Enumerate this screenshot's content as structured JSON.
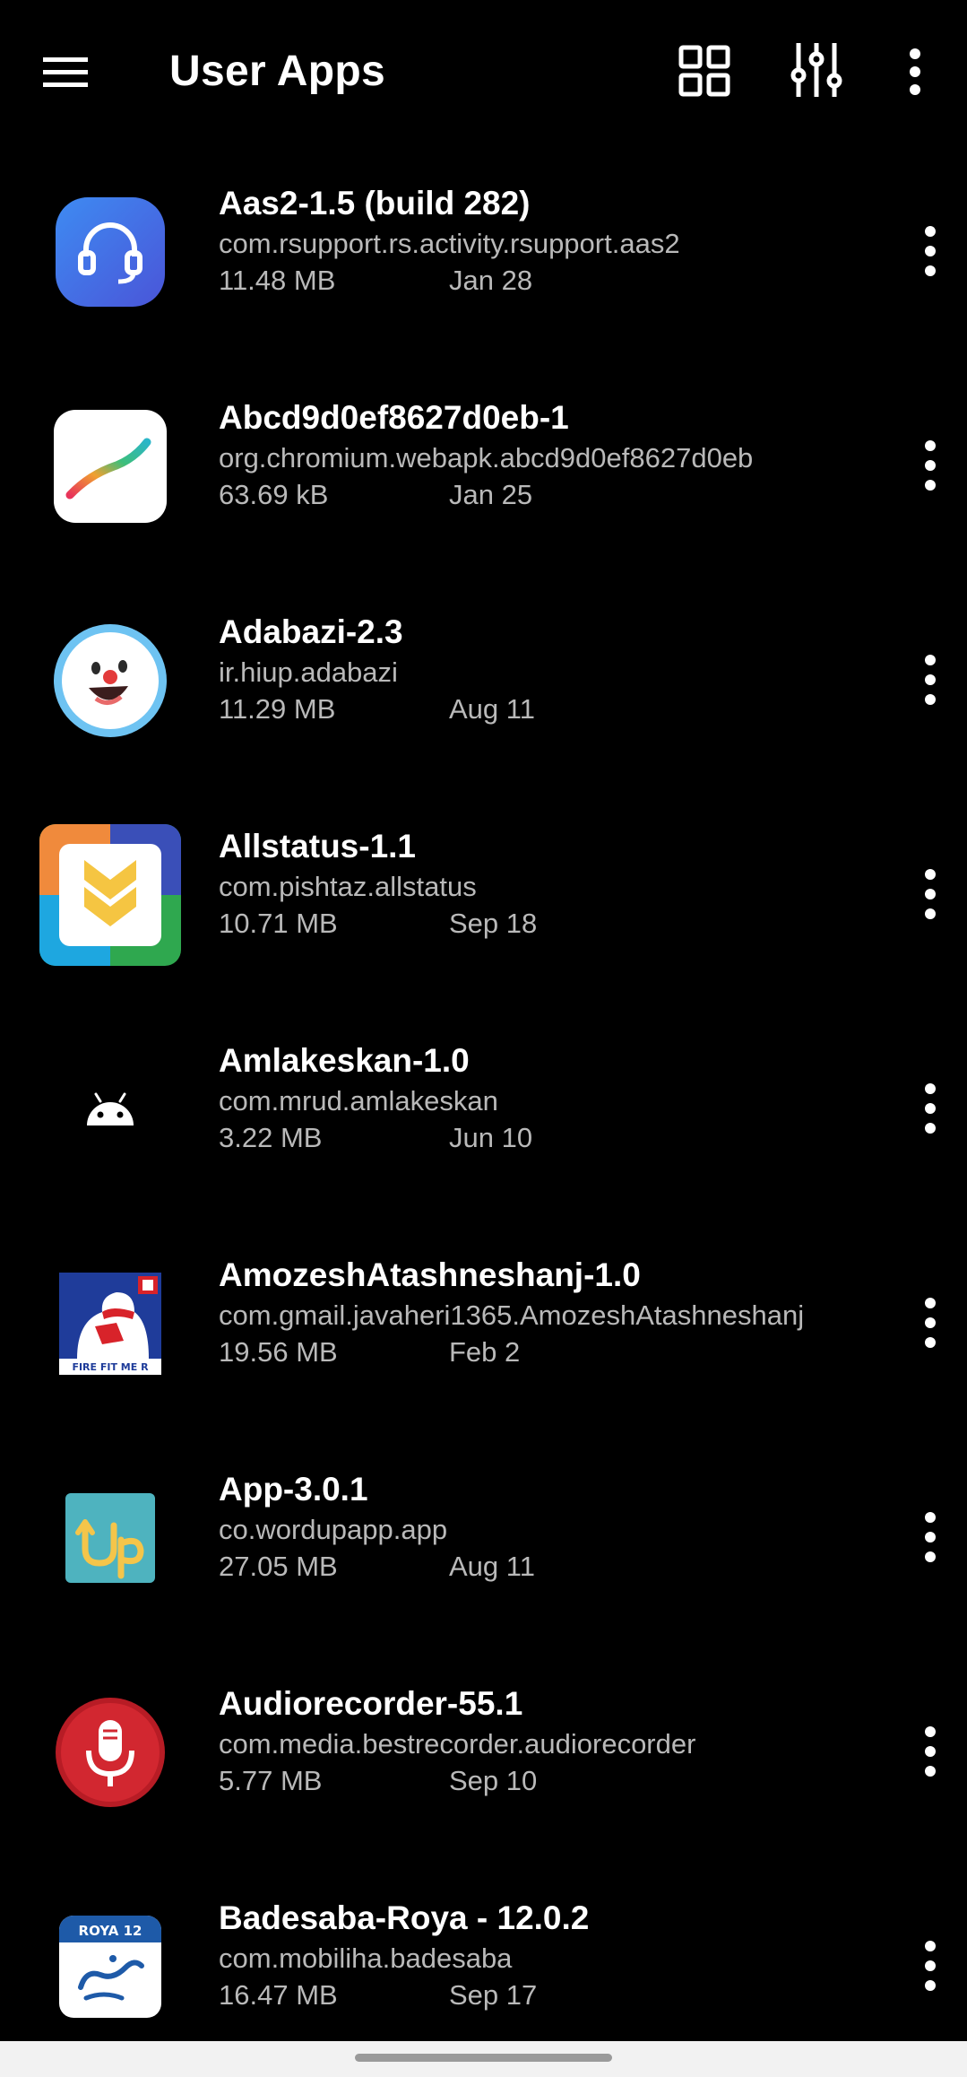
{
  "app_bar": {
    "title": "User Apps",
    "icons": [
      "hamburger-menu-icon",
      "grid-view-icon",
      "filter-sliders-icon",
      "more-vert-icon"
    ]
  },
  "apps": [
    {
      "name": "Aas2-1.5 (build 282)",
      "package": "com.rsupport.rs.activity.rsupport.aas2",
      "size": "11.48 MB",
      "date": "Jan 28",
      "icon": "headset-icon",
      "icon_color": "#3F6FE8"
    },
    {
      "name": "Abcd9d0ef8627d0eb-1",
      "package": "org.chromium.webapk.abcd9d0ef8627d0eb",
      "size": "63.69 kB",
      "date": "Jan 25",
      "icon": "gradient-swoosh-icon",
      "icon_color": "#FFFFFF"
    },
    {
      "name": "Adabazi-2.3",
      "package": "ir.hiup.adabazi",
      "size": "11.29 MB",
      "date": "Aug 11",
      "icon": "laughing-face-icon",
      "icon_color": "#5BB8F0"
    },
    {
      "name": "Allstatus-1.1",
      "package": "com.pishtaz.allstatus",
      "size": "10.71 MB",
      "date": "Sep 18",
      "icon": "chevron-shield-icon",
      "icon_color": "#F5C542"
    },
    {
      "name": "Amlakeskan-1.0",
      "package": "com.mrud.amlakeskan",
      "size": "3.22 MB",
      "date": "Jun 10",
      "icon": "android-icon",
      "icon_color": "#FFFFFF"
    },
    {
      "name": "AmozeshAtashneshanj-1.0",
      "package": "com.gmail.javaheri1365.AmozeshAtashneshanj",
      "size": "19.56 MB",
      "date": "Feb 2",
      "icon": "firefighter-icon",
      "icon_color": "#D8232A",
      "icon_text": "FIRE FIT ME R"
    },
    {
      "name": "App-3.0.1",
      "package": "co.wordupapp.app",
      "size": "27.05 MB",
      "date": "Aug 11",
      "icon": "up-arrow-icon",
      "icon_color": "#4EB3BF",
      "icon_text": "Up"
    },
    {
      "name": "Audiorecorder-55.1",
      "package": "com.media.bestrecorder.audiorecorder",
      "size": "5.77 MB",
      "date": "Sep 10",
      "icon": "microphone-icon",
      "icon_color": "#D22730"
    },
    {
      "name": "Badesaba-Roya - 12.0.2",
      "package": "com.mobiliha.badesaba",
      "size": "16.47 MB",
      "date": "Sep 17",
      "icon": "calendar-logo-icon",
      "icon_color": "#1E5AA8",
      "icon_text": "ROYA 12"
    }
  ],
  "row_actions_icon": "more-vert-icon"
}
